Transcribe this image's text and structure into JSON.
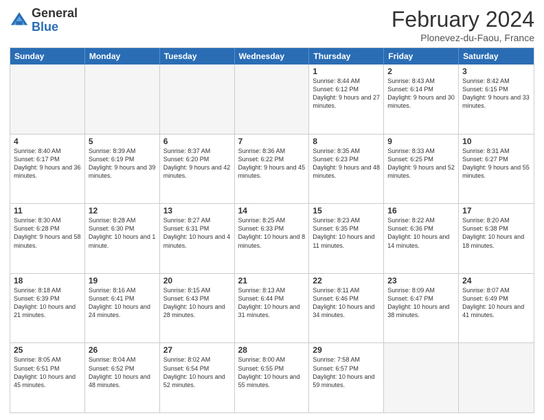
{
  "logo": {
    "general": "General",
    "blue": "Blue"
  },
  "header": {
    "month_year": "February 2024",
    "location": "Plonevez-du-Faou, France"
  },
  "days_of_week": [
    "Sunday",
    "Monday",
    "Tuesday",
    "Wednesday",
    "Thursday",
    "Friday",
    "Saturday"
  ],
  "rows": [
    [
      {
        "day": "",
        "info": "",
        "empty": true
      },
      {
        "day": "",
        "info": "",
        "empty": true
      },
      {
        "day": "",
        "info": "",
        "empty": true
      },
      {
        "day": "",
        "info": "",
        "empty": true
      },
      {
        "day": "1",
        "info": "Sunrise: 8:44 AM\nSunset: 6:12 PM\nDaylight: 9 hours and 27 minutes.",
        "empty": false
      },
      {
        "day": "2",
        "info": "Sunrise: 8:43 AM\nSunset: 6:14 PM\nDaylight: 9 hours and 30 minutes.",
        "empty": false
      },
      {
        "day": "3",
        "info": "Sunrise: 8:42 AM\nSunset: 6:15 PM\nDaylight: 9 hours and 33 minutes.",
        "empty": false
      }
    ],
    [
      {
        "day": "4",
        "info": "Sunrise: 8:40 AM\nSunset: 6:17 PM\nDaylight: 9 hours and 36 minutes.",
        "empty": false
      },
      {
        "day": "5",
        "info": "Sunrise: 8:39 AM\nSunset: 6:19 PM\nDaylight: 9 hours and 39 minutes.",
        "empty": false
      },
      {
        "day": "6",
        "info": "Sunrise: 8:37 AM\nSunset: 6:20 PM\nDaylight: 9 hours and 42 minutes.",
        "empty": false
      },
      {
        "day": "7",
        "info": "Sunrise: 8:36 AM\nSunset: 6:22 PM\nDaylight: 9 hours and 45 minutes.",
        "empty": false
      },
      {
        "day": "8",
        "info": "Sunrise: 8:35 AM\nSunset: 6:23 PM\nDaylight: 9 hours and 48 minutes.",
        "empty": false
      },
      {
        "day": "9",
        "info": "Sunrise: 8:33 AM\nSunset: 6:25 PM\nDaylight: 9 hours and 52 minutes.",
        "empty": false
      },
      {
        "day": "10",
        "info": "Sunrise: 8:31 AM\nSunset: 6:27 PM\nDaylight: 9 hours and 55 minutes.",
        "empty": false
      }
    ],
    [
      {
        "day": "11",
        "info": "Sunrise: 8:30 AM\nSunset: 6:28 PM\nDaylight: 9 hours and 58 minutes.",
        "empty": false
      },
      {
        "day": "12",
        "info": "Sunrise: 8:28 AM\nSunset: 6:30 PM\nDaylight: 10 hours and 1 minute.",
        "empty": false
      },
      {
        "day": "13",
        "info": "Sunrise: 8:27 AM\nSunset: 6:31 PM\nDaylight: 10 hours and 4 minutes.",
        "empty": false
      },
      {
        "day": "14",
        "info": "Sunrise: 8:25 AM\nSunset: 6:33 PM\nDaylight: 10 hours and 8 minutes.",
        "empty": false
      },
      {
        "day": "15",
        "info": "Sunrise: 8:23 AM\nSunset: 6:35 PM\nDaylight: 10 hours and 11 minutes.",
        "empty": false
      },
      {
        "day": "16",
        "info": "Sunrise: 8:22 AM\nSunset: 6:36 PM\nDaylight: 10 hours and 14 minutes.",
        "empty": false
      },
      {
        "day": "17",
        "info": "Sunrise: 8:20 AM\nSunset: 6:38 PM\nDaylight: 10 hours and 18 minutes.",
        "empty": false
      }
    ],
    [
      {
        "day": "18",
        "info": "Sunrise: 8:18 AM\nSunset: 6:39 PM\nDaylight: 10 hours and 21 minutes.",
        "empty": false
      },
      {
        "day": "19",
        "info": "Sunrise: 8:16 AM\nSunset: 6:41 PM\nDaylight: 10 hours and 24 minutes.",
        "empty": false
      },
      {
        "day": "20",
        "info": "Sunrise: 8:15 AM\nSunset: 6:43 PM\nDaylight: 10 hours and 28 minutes.",
        "empty": false
      },
      {
        "day": "21",
        "info": "Sunrise: 8:13 AM\nSunset: 6:44 PM\nDaylight: 10 hours and 31 minutes.",
        "empty": false
      },
      {
        "day": "22",
        "info": "Sunrise: 8:11 AM\nSunset: 6:46 PM\nDaylight: 10 hours and 34 minutes.",
        "empty": false
      },
      {
        "day": "23",
        "info": "Sunrise: 8:09 AM\nSunset: 6:47 PM\nDaylight: 10 hours and 38 minutes.",
        "empty": false
      },
      {
        "day": "24",
        "info": "Sunrise: 8:07 AM\nSunset: 6:49 PM\nDaylight: 10 hours and 41 minutes.",
        "empty": false
      }
    ],
    [
      {
        "day": "25",
        "info": "Sunrise: 8:05 AM\nSunset: 6:51 PM\nDaylight: 10 hours and 45 minutes.",
        "empty": false
      },
      {
        "day": "26",
        "info": "Sunrise: 8:04 AM\nSunset: 6:52 PM\nDaylight: 10 hours and 48 minutes.",
        "empty": false
      },
      {
        "day": "27",
        "info": "Sunrise: 8:02 AM\nSunset: 6:54 PM\nDaylight: 10 hours and 52 minutes.",
        "empty": false
      },
      {
        "day": "28",
        "info": "Sunrise: 8:00 AM\nSunset: 6:55 PM\nDaylight: 10 hours and 55 minutes.",
        "empty": false
      },
      {
        "day": "29",
        "info": "Sunrise: 7:58 AM\nSunset: 6:57 PM\nDaylight: 10 hours and 59 minutes.",
        "empty": false
      },
      {
        "day": "",
        "info": "",
        "empty": true
      },
      {
        "day": "",
        "info": "",
        "empty": true
      }
    ]
  ]
}
